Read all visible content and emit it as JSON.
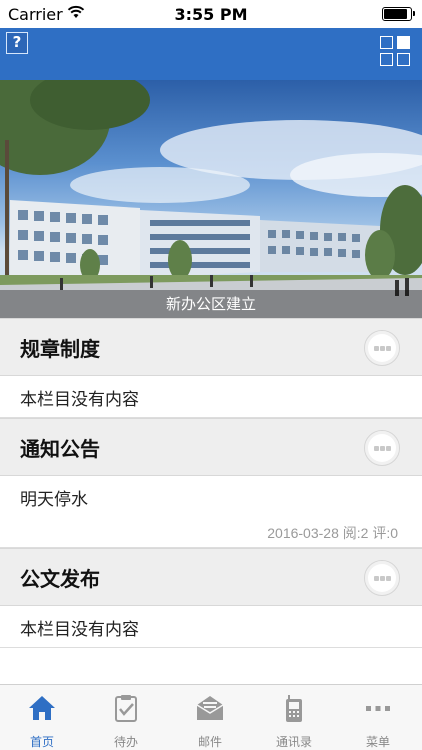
{
  "status_bar": {
    "carrier": "Carrier",
    "time": "3:55 PM",
    "battery_level": 0.9
  },
  "nav": {
    "help_label": "?",
    "help_icon": "help-icon",
    "grid_icon": "grid-menu-icon",
    "accent": "#2f6fc4"
  },
  "banner": {
    "caption": "新办公区建立"
  },
  "sections": [
    {
      "title": "规章制度",
      "items": [
        {
          "text": "本栏目没有内容"
        }
      ]
    },
    {
      "title": "通知公告",
      "items": [
        {
          "text": "明天停水",
          "meta": "2016-03-28 阅:2 评:0"
        }
      ]
    },
    {
      "title": "公文发布",
      "items": [
        {
          "text": "本栏目没有内容"
        }
      ]
    }
  ],
  "tabs": [
    {
      "label": "首页",
      "icon": "home-icon",
      "active": true
    },
    {
      "label": "待办",
      "icon": "clipboard-check-icon",
      "active": false
    },
    {
      "label": "邮件",
      "icon": "mail-icon",
      "active": false
    },
    {
      "label": "通讯录",
      "icon": "phone-icon",
      "active": false
    },
    {
      "label": "菜单",
      "icon": "more-icon",
      "active": false
    }
  ]
}
